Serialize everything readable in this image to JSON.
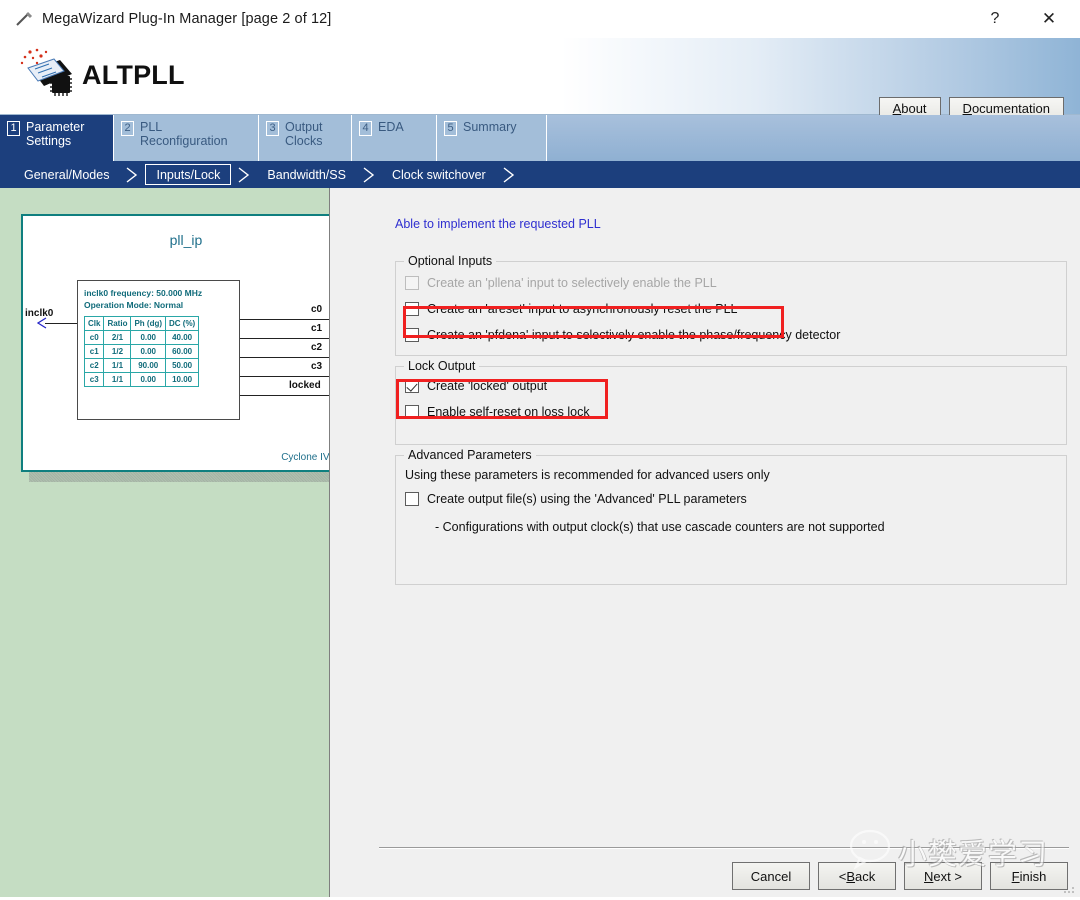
{
  "window": {
    "title": "MegaWizard Plug-In Manager [page 2 of 12]",
    "title_icon": "wand-icon",
    "help_label": "?",
    "close_label": "✕"
  },
  "header": {
    "product": "ALTPLL",
    "logo_icon": "altpll-chip-icon",
    "buttons": [
      {
        "label_pre": "A",
        "label_key": "A",
        "label_post": "bout",
        "full": "About",
        "name": "about-button"
      },
      {
        "label_key": "D",
        "label_post": "ocumentation",
        "full": "Documentation",
        "name": "documentation-button"
      }
    ]
  },
  "tabs": [
    {
      "num": "1",
      "label": "Parameter\nSettings",
      "active": true
    },
    {
      "num": "2",
      "label": "PLL\nReconfiguration",
      "active": false
    },
    {
      "num": "3",
      "label": "Output\nClocks",
      "active": false
    },
    {
      "num": "4",
      "label": "EDA",
      "active": false
    },
    {
      "num": "5",
      "label": "Summary",
      "active": false
    }
  ],
  "breadcrumbs": [
    {
      "label": "General/Modes",
      "selected": false
    },
    {
      "label": "Inputs/Lock",
      "selected": true
    },
    {
      "label": "Bandwidth/SS",
      "selected": false
    },
    {
      "label": "Clock switchover",
      "selected": false
    }
  ],
  "preview": {
    "block_name": "pll_ip",
    "device": "Cyclone IV E",
    "info_lines": [
      "inclk0 frequency: 50.000 MHz",
      "Operation Mode: Normal"
    ],
    "input_ports": [
      "inclk0"
    ],
    "output_ports": [
      "c0",
      "c1",
      "c2",
      "c3",
      "locked"
    ],
    "table": {
      "headers": [
        "Clk",
        "Ratio",
        "Ph (dg)",
        "DC (%)"
      ],
      "rows": [
        [
          "c0",
          "2/1",
          "0.00",
          "40.00"
        ],
        [
          "c1",
          "1/2",
          "0.00",
          "60.00"
        ],
        [
          "c2",
          "1/1",
          "90.00",
          "50.00"
        ],
        [
          "c3",
          "1/1",
          "0.00",
          "10.00"
        ]
      ]
    }
  },
  "main": {
    "status": "Able to implement the requested PLL",
    "status_color": "#2f2fd0",
    "optional_inputs": {
      "title": "Optional Inputs",
      "items": [
        {
          "label": "Create an 'pllena' input to selectively enable the PLL",
          "checked": false,
          "disabled": true
        },
        {
          "label": "Create an 'areset' input to asynchronously reset the PLL",
          "checked": false,
          "disabled": false
        },
        {
          "label": "Create an 'pfdena' input to selectively enable the phase/frequency detector",
          "checked": false,
          "disabled": false
        }
      ]
    },
    "lock_output": {
      "title": "Lock Output",
      "items": [
        {
          "label": "Create 'locked' output",
          "checked": true,
          "disabled": false
        },
        {
          "label": "Enable self-reset on loss lock",
          "checked": false,
          "disabled": false
        }
      ]
    },
    "advanced": {
      "title": "Advanced Parameters",
      "description": "Using these parameters is recommended for advanced users only",
      "items": [
        {
          "label": "Create output file(s) using the 'Advanced' PLL parameters",
          "checked": false,
          "disabled": false
        }
      ],
      "note": "- Configurations with output clock(s) that use cascade counters are not supported"
    },
    "highlight_color": "#f02020"
  },
  "footer": {
    "buttons": [
      {
        "full": "Cancel",
        "pre": "Cancel",
        "key": "",
        "post": "",
        "name": "cancel-button"
      },
      {
        "full": "< Back",
        "pre": "< ",
        "key": "B",
        "post": "ack",
        "name": "back-button"
      },
      {
        "full": "Next >",
        "pre": "",
        "key": "N",
        "post": "ext >",
        "name": "next-button"
      },
      {
        "full": "Finish",
        "pre": "",
        "key": "F",
        "post": "inish",
        "name": "finish-button"
      }
    ]
  },
  "watermark": {
    "text": "小樊爱学习",
    "icon": "wechat-icon"
  }
}
